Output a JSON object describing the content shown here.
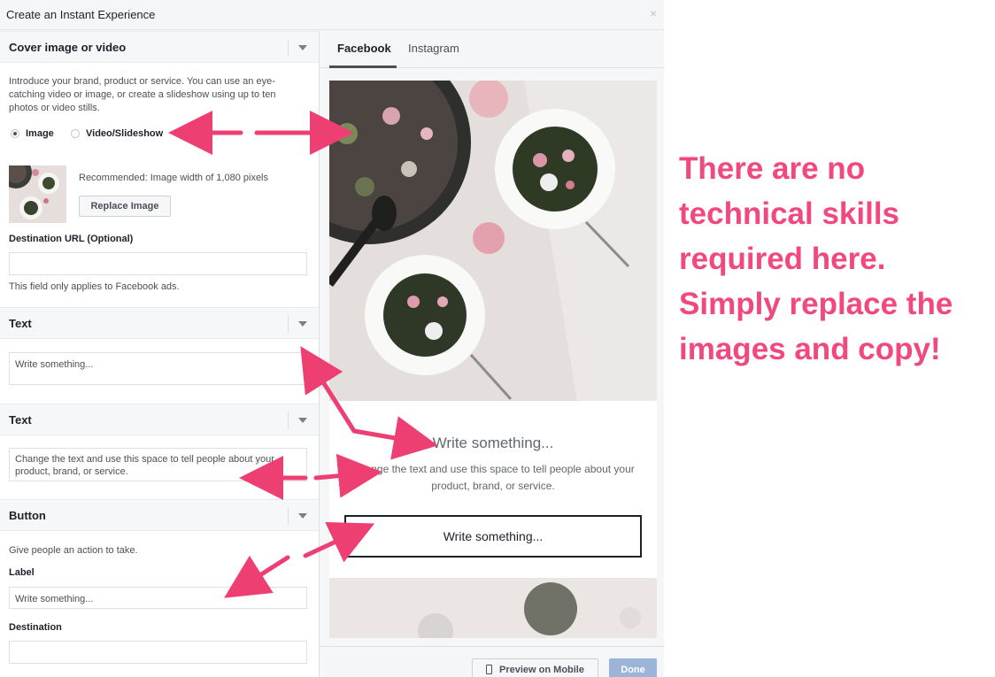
{
  "dialog": {
    "title": "Create an Instant Experience",
    "close": "×"
  },
  "cover": {
    "title": "Cover image or video",
    "intro": "Introduce your brand, product or service. You can use an eye-catching video or image, or create a slideshow using up to ten photos or video stills.",
    "radio_image": "Image",
    "radio_video": "Video/Slideshow",
    "recommended": "Recommended: Image width of 1,080 pixels",
    "replace_button": "Replace Image",
    "destination_label": "Destination URL (Optional)",
    "destination_value": "",
    "destination_note": "This field only applies to Facebook ads."
  },
  "text1": {
    "title": "Text",
    "value": "Write something..."
  },
  "text2": {
    "title": "Text",
    "value": "Change the text and use this space to tell people about your product, brand, or service."
  },
  "button_section": {
    "title": "Button",
    "intro": "Give people an action to take.",
    "label_label": "Label",
    "label_value": "Write something...",
    "destination_label": "Destination"
  },
  "preview": {
    "tabs": [
      "Facebook",
      "Instagram"
    ],
    "headline": "Write something...",
    "body": "Change the text and use this space to tell people about your product, brand, or service.",
    "button_label": "Write something..."
  },
  "footer": {
    "preview_mobile": "Preview on Mobile",
    "done": "Done"
  },
  "annotation": {
    "lines": [
      "There are no",
      "technical skills",
      "required here.",
      "Simply replace the",
      "images and copy!"
    ]
  },
  "colors": {
    "annotation": "#f0487f",
    "arrow": "#ee3f73"
  }
}
